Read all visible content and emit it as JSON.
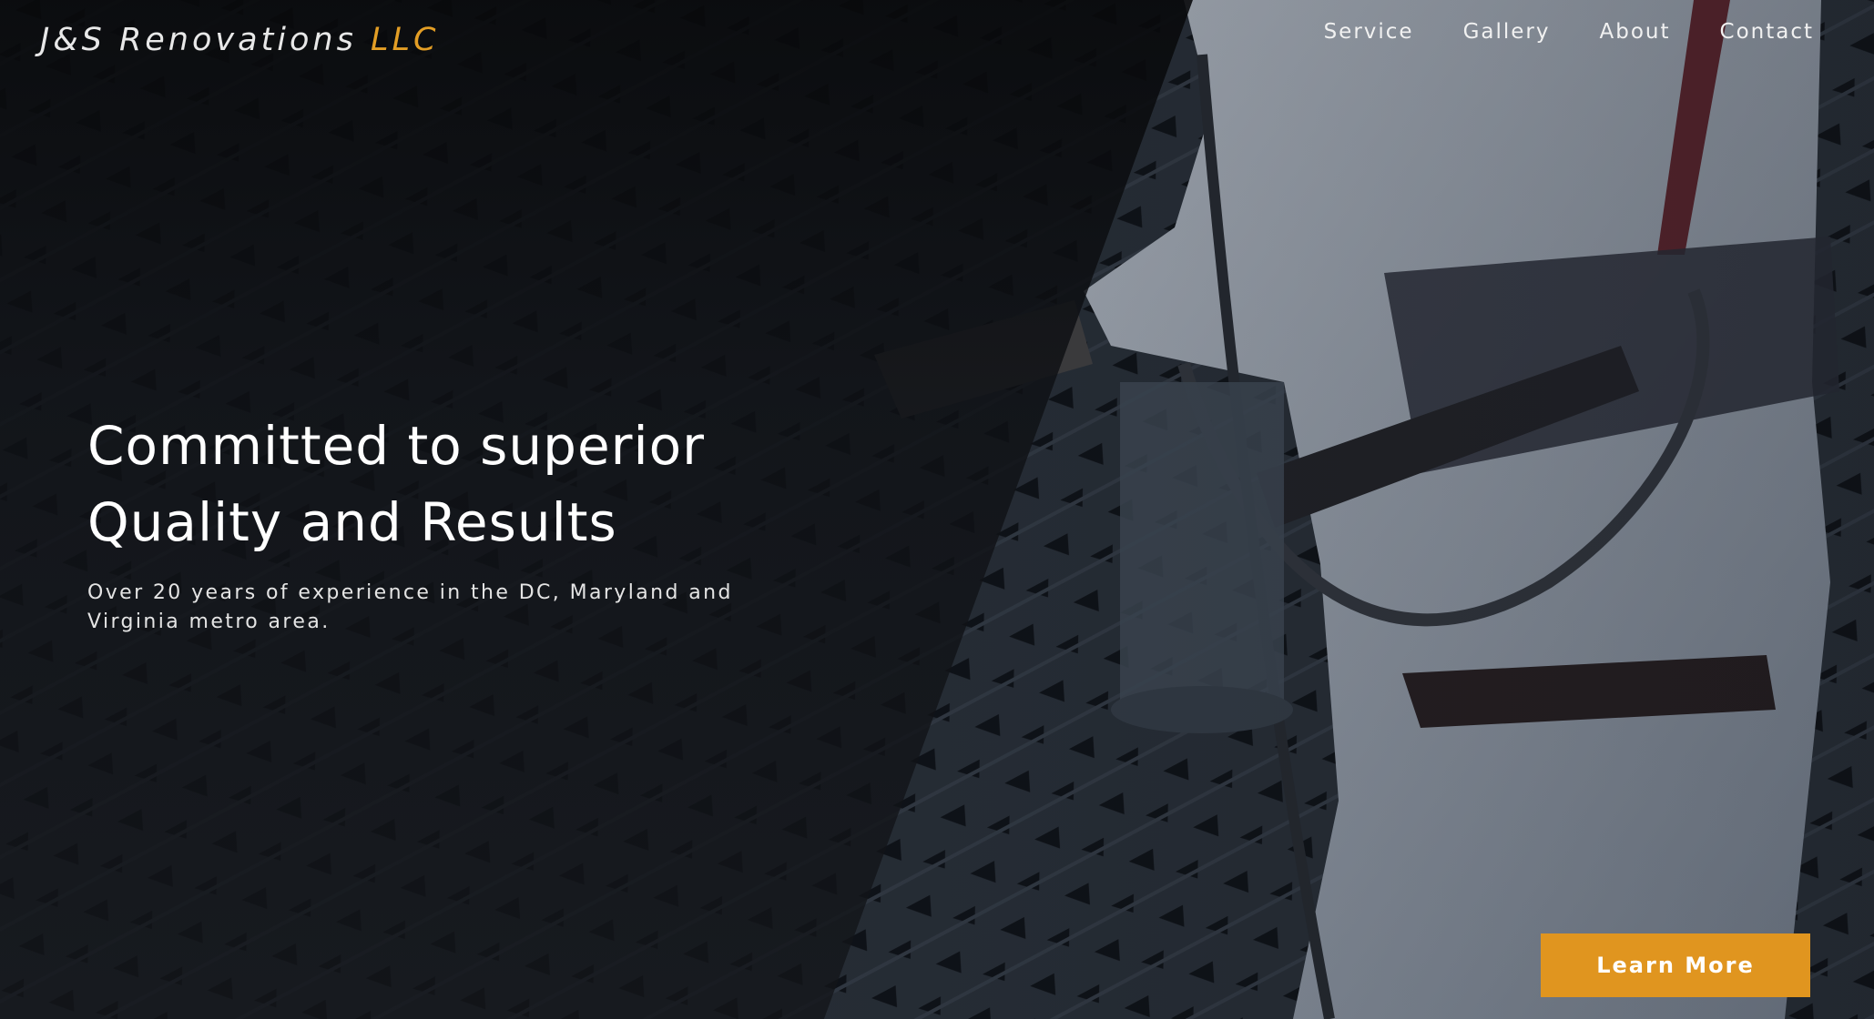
{
  "brand": {
    "name": "J&S Renovations",
    "suffix": "LLC"
  },
  "nav": {
    "items": [
      "Service",
      "Gallery",
      "About",
      "Contact"
    ]
  },
  "hero": {
    "headline_line1": "Committed to superior",
    "headline_line2": "Quality and Results",
    "subtext_line1": "Over 20 years of experience in the DC, Maryland and",
    "subtext_line2": "Virginia metro area.",
    "cta_label": "Learn More"
  },
  "colors": {
    "accent": "#e0951f",
    "text": "#ffffff",
    "background": "#0c0d10"
  }
}
